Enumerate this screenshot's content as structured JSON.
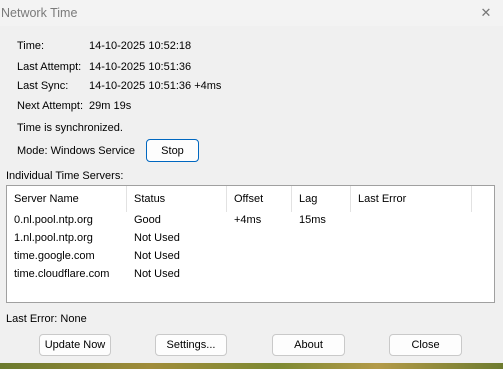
{
  "window": {
    "title": "Network Time",
    "close_glyph": "✕"
  },
  "info": {
    "time_label": "Time:",
    "time_value": "14-10-2025 10:52:18",
    "last_attempt_label": "Last Attempt:",
    "last_attempt_value": "14-10-2025 10:51:36",
    "last_sync_label": "Last Sync:",
    "last_sync_value": "14-10-2025 10:51:36 +4ms",
    "next_attempt_label": "Next Attempt:",
    "next_attempt_value": "29m 19s",
    "status_text": "Time is synchronized.",
    "mode_text": "Mode: Windows Service",
    "stop_label": "Stop"
  },
  "servers": {
    "section_label": "Individual Time Servers:",
    "columns": [
      "Server Name",
      "Status",
      "Offset",
      "Lag",
      "Last Error"
    ],
    "rows": [
      {
        "name": "0.nl.pool.ntp.org",
        "status": "Good",
        "offset": "+4ms",
        "lag": "15ms",
        "error": ""
      },
      {
        "name": "1.nl.pool.ntp.org",
        "status": "Not Used",
        "offset": "",
        "lag": "",
        "error": ""
      },
      {
        "name": "time.google.com",
        "status": "Not Used",
        "offset": "",
        "lag": "",
        "error": ""
      },
      {
        "name": "time.cloudflare.com",
        "status": "Not Used",
        "offset": "",
        "lag": "",
        "error": ""
      }
    ]
  },
  "footer": {
    "last_error_text": "Last Error:  None",
    "update_now_label": "Update Now",
    "settings_label": "Settings...",
    "about_label": "About",
    "close_label": "Close"
  }
}
